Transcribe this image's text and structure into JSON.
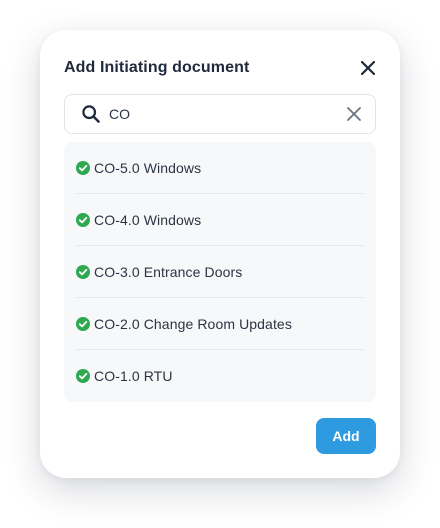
{
  "dialog": {
    "title": "Add Initiating document",
    "close_icon": "close-icon"
  },
  "search": {
    "value": "CO",
    "search_icon": "search-icon",
    "clear_icon": "clear-icon"
  },
  "results": [
    {
      "label": "CO-5.0 Windows",
      "selected": true
    },
    {
      "label": "CO-4.0 Windows",
      "selected": true
    },
    {
      "label": "CO-3.0 Entrance Doors",
      "selected": true
    },
    {
      "label": "CO-2.0 Change Room Updates",
      "selected": true
    },
    {
      "label": "CO-1.0 RTU",
      "selected": true
    }
  ],
  "actions": {
    "add_label": "Add"
  },
  "colors": {
    "title": "#1f2a3c",
    "text": "#2b3444",
    "check": "#2fa84f",
    "primary_button": "#2e9be0",
    "list_background": "#f7f8f9"
  }
}
